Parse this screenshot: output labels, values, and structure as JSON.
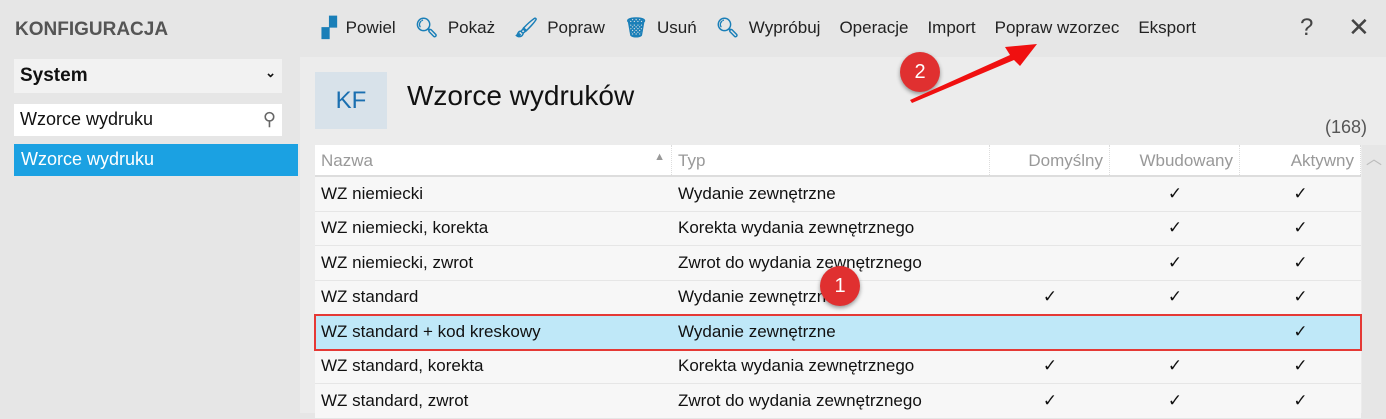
{
  "sidebar": {
    "title": "KONFIGURACJA",
    "module": "System",
    "search_value": "Wzorce wydruku",
    "selected_item": "Wzorce wydruku"
  },
  "toolbar": {
    "items": [
      {
        "icon": "copy-icon",
        "label": "Powiel"
      },
      {
        "icon": "search-icon",
        "label": "Pokaż"
      },
      {
        "icon": "brush-icon",
        "label": "Popraw"
      },
      {
        "icon": "trash-icon",
        "label": "Usuń"
      },
      {
        "icon": "search-icon",
        "label": "Wypróbuj"
      },
      {
        "label": "Operacje"
      },
      {
        "label": "Import"
      },
      {
        "label": "Popraw wzorzec"
      },
      {
        "label": "Eksport"
      }
    ],
    "help": "?",
    "close": "✕"
  },
  "page": {
    "badge": "KF",
    "title": "Wzorce wydruków",
    "count": "(168)"
  },
  "table": {
    "columns": [
      "Nazwa",
      "Typ",
      "Domyślny",
      "Wbudowany",
      "Aktywny"
    ],
    "rows": [
      {
        "name": "WZ niemiecki",
        "type": "Wydanie zewnętrzne",
        "default": "",
        "builtin": "✓",
        "active": "✓"
      },
      {
        "name": "WZ niemiecki, korekta",
        "type": "Korekta wydania zewnętrznego",
        "default": "",
        "builtin": "✓",
        "active": "✓"
      },
      {
        "name": "WZ niemiecki, zwrot",
        "type": "Zwrot do wydania zewnętrznego",
        "default": "",
        "builtin": "✓",
        "active": "✓"
      },
      {
        "name": "WZ standard",
        "type": "Wydanie zewnętrzne",
        "default": "✓",
        "builtin": "✓",
        "active": "✓"
      },
      {
        "name": "WZ standard + kod kreskowy",
        "type": "Wydanie zewnętrzne",
        "default": "",
        "builtin": "",
        "active": "✓",
        "selected": true
      },
      {
        "name": "WZ standard, korekta",
        "type": "Korekta wydania zewnętrznego",
        "default": "✓",
        "builtin": "✓",
        "active": "✓"
      },
      {
        "name": "WZ standard, zwrot",
        "type": "Zwrot do wydania zewnętrznego",
        "default": "✓",
        "builtin": "✓",
        "active": "✓"
      }
    ]
  },
  "annotations": {
    "step1": "1",
    "step2": "2",
    "color": "#e53935"
  }
}
